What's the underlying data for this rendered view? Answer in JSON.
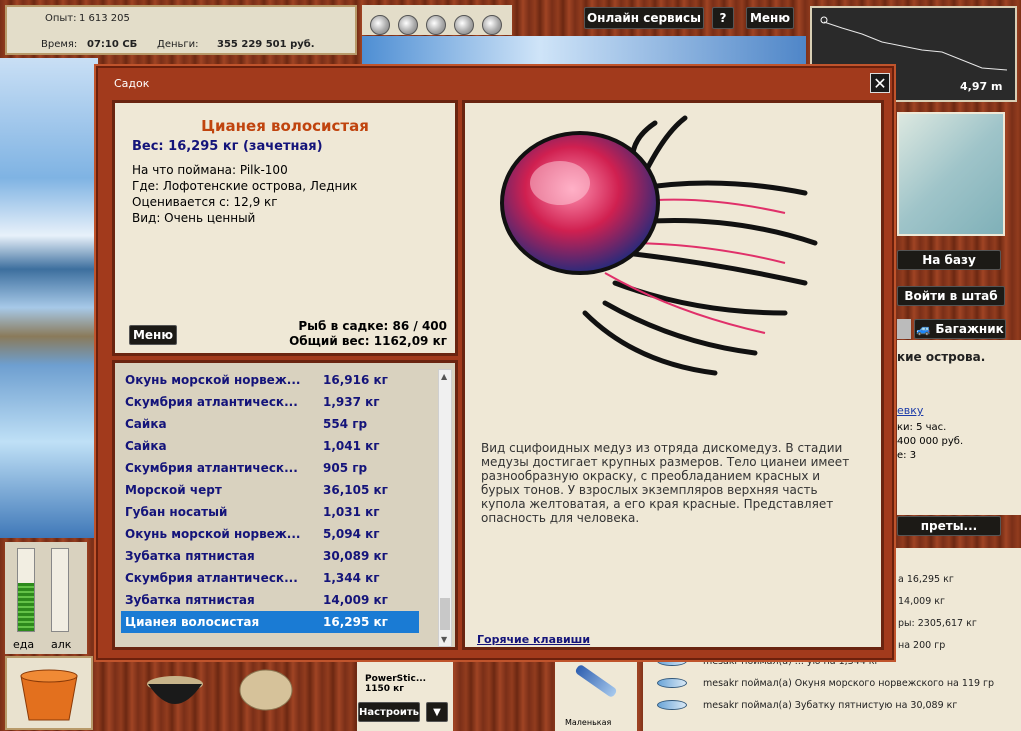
{
  "stats": {
    "exp_label": "Опыт:",
    "exp_value": "1 613 205",
    "time_label": "Время:",
    "time_value": "07:10 СБ",
    "money_label": "Деньги:",
    "money_value": "355 229 501 руб."
  },
  "topbar": {
    "online": "Онлайн сервисы",
    "help": "?",
    "menu": "Меню"
  },
  "map": {
    "distance": "4,97 m"
  },
  "right": {
    "to_base": "На базу",
    "enter_hq": "Войти в штаб",
    "trunk": "Багажник",
    "place_fragment": "кие острова.",
    "link_fragment": "евку",
    "line1": "ки: 5 час.",
    "line2": "400 000 руб.",
    "line3": "е: 3",
    "bans": "преты..."
  },
  "modal": {
    "title": "Садок",
    "fish_name": "Цианея волосистая",
    "weight_line": "Вес: 16,295 кг (зачетная)",
    "caught_with": "На что поймана: Pilk-100",
    "where": "Где: Лофотенские острова, Ледник",
    "valued": "Оценивается с: 12,9 кг",
    "kind": "Вид: Очень ценный",
    "menu_btn": "Меню",
    "fish_count": "Рыб в садке: 86 / 400",
    "total_weight": "Общий вес: 1162,09 кг",
    "description": "Вид сцифоидных медуз из отряда дискомедуз. В стадии медузы достигает крупных размеров. Тело цианеи имеет разнообразную окраску, с преобладанием красных и бурых тонов. У взрослых экземпляров верхняя часть купола желтоватая, а его края красные. Представляет опасность для человека.",
    "hotkeys": "Горячие клавиши",
    "rows": [
      {
        "name": "Окунь морской норвеж...",
        "weight": "16,916 кг"
      },
      {
        "name": "Скумбрия атлантическ...",
        "weight": "1,937 кг"
      },
      {
        "name": "Сайка",
        "weight": "554 гр"
      },
      {
        "name": "Сайка",
        "weight": "1,041 кг"
      },
      {
        "name": "Скумбрия атлантическ...",
        "weight": "905 гр"
      },
      {
        "name": "Морской черт",
        "weight": "36,105 кг"
      },
      {
        "name": "Губан носатый",
        "weight": "1,031 кг"
      },
      {
        "name": "Окунь морской норвеж...",
        "weight": "5,094 кг"
      },
      {
        "name": "Зубатка пятнистая",
        "weight": "30,089 кг"
      },
      {
        "name": "Скумбрия атлантическ...",
        "weight": "1,344 кг"
      },
      {
        "name": "Зубатка пятнистая",
        "weight": "14,009 кг"
      },
      {
        "name": "Цианея волосистая",
        "weight": "16,295 кг"
      }
    ]
  },
  "meters": {
    "food": "еда",
    "alc": "алк"
  },
  "bottom": {
    "rod_name": "PowerStic...",
    "rod_weight": "1150 кг",
    "setup": "Настроить",
    "dropdown": "▼",
    "lure_caption": "Маленькая"
  },
  "feed": {
    "l1": "а 16,295 кг",
    "l2": "14,009 кг",
    "l3": "ры: 2305,617 кг",
    "l4": "на 200 гр",
    "l5": "mesakr поймал(а) ... ую на 1,344 кг",
    "l6": "mesakr поймал(а) Окуня морского норвежского на 119 гр",
    "l7": "mesakr поймал(а) Зубатку пятнистую на 30,089 кг"
  },
  "colors": {
    "selection": "#1a7bd4",
    "title_orange": "#c0440e",
    "text_blue": "#14147a"
  }
}
